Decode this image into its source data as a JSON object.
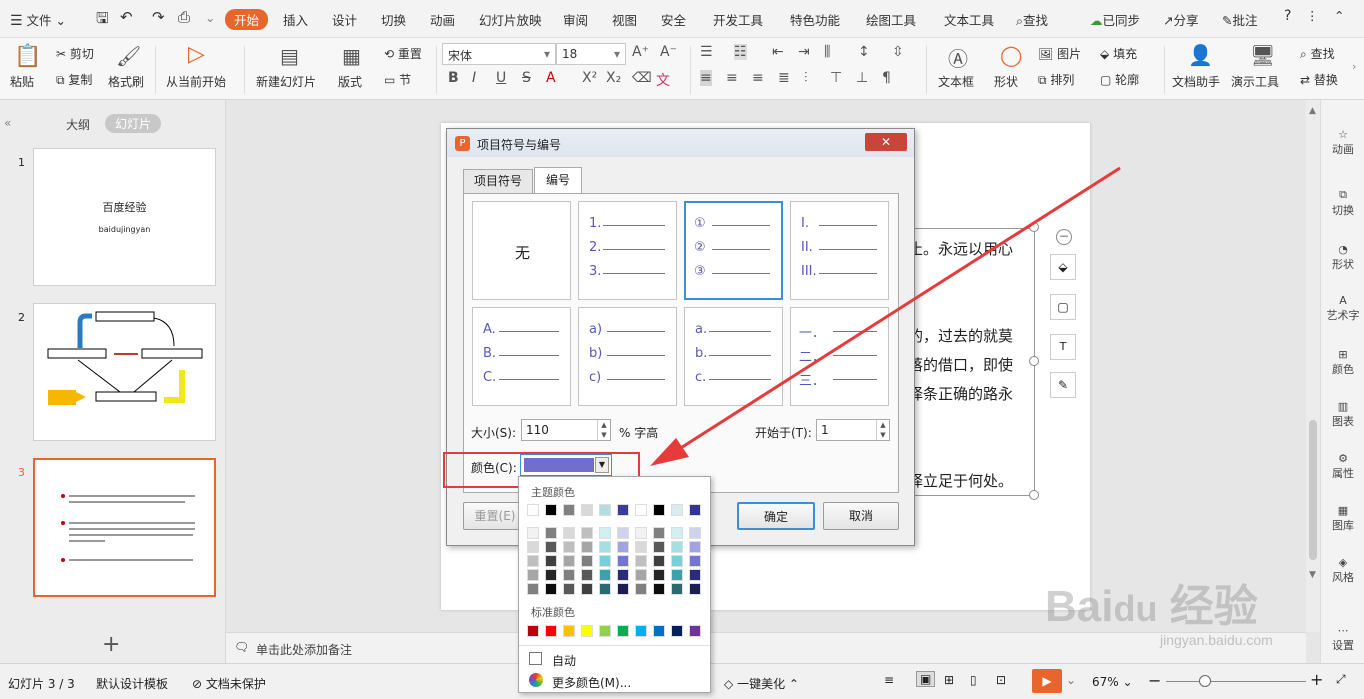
{
  "menu": {
    "file": "文件",
    "tabs": [
      "开始",
      "插入",
      "设计",
      "切换",
      "动画",
      "幻灯片放映",
      "审阅",
      "视图",
      "安全",
      "开发工具",
      "特色功能",
      "绘图工具",
      "文本工具"
    ],
    "search": "查找",
    "sync": "已同步",
    "share": "分享",
    "comment": "批注"
  },
  "ribbon": {
    "paste": "粘贴",
    "cut": "剪切",
    "copy": "复制",
    "format_painter": "格式刷",
    "play_current": "从当前开始",
    "new_slide": "新建幻灯片",
    "layout": "版式",
    "reset": "重置",
    "section": "节",
    "font": "宋体",
    "font_size": "18",
    "textbox": "文本框",
    "shape": "形状",
    "picture": "图片",
    "arrange": "排列",
    "fill": "填充",
    "outline": "轮廓",
    "doc_assistant": "文档助手",
    "present_tools": "演示工具",
    "find": "查找",
    "replace": "替换"
  },
  "left": {
    "outline_tab": "大纲",
    "slides_tab": "幻灯片",
    "thumb1_title": "百度经验",
    "thumb1_sub": "baidujingyan",
    "add": "+"
  },
  "slide_text": [
    "止。永远以用心",
    "的，过去的就莫",
    "落的借口，即使",
    "择条正确的路永",
    "择立足于何处。"
  ],
  "notes": "单击此处添加备注",
  "right_panel": [
    "动画",
    "切换",
    "形状",
    "艺术字",
    "颜色",
    "图表",
    "属性",
    "图库",
    "风格",
    "设置"
  ],
  "status": {
    "slide_num": "幻灯片 3 / 3",
    "template": "默认设计模板",
    "protect": "文档未保护",
    "beautify": "一键美化",
    "zoom": "67%"
  },
  "dialog": {
    "title": "项目符号与编号",
    "tab_bullet": "项目符号",
    "tab_number": "编号",
    "none": "无",
    "size_label": "大小(S):",
    "size_value": "110",
    "pct": "% 字高",
    "start_label": "开始于(T):",
    "start_value": "1",
    "color_label": "颜色(C):",
    "reset": "重置(E)",
    "ok": "确定",
    "cancel": "取消",
    "styles": [
      [
        "1.",
        "2.",
        "3."
      ],
      [
        "①",
        "②",
        "③"
      ],
      [
        "I.",
        "II.",
        "III."
      ],
      [
        "A.",
        "B.",
        "C."
      ],
      [
        "a)",
        "b)",
        "c)"
      ],
      [
        "a.",
        "b.",
        "c."
      ],
      [
        "一．",
        "二．",
        "三．"
      ]
    ]
  },
  "palette": {
    "theme_label": "主题颜色",
    "standard_label": "标准颜色",
    "auto": "自动",
    "more": "更多颜色(M)...",
    "selected_color": "#7070cc",
    "theme_top": [
      "#ffffff",
      "#000000",
      "#808080",
      "#d9d9d9",
      "#b4dde2",
      "#3b3aa0",
      "#ffffff",
      "#000000",
      "#d9eef0",
      "#2f3698"
    ],
    "theme_cols": [
      [
        "#f2f2f2",
        "#d9d9d9",
        "#bfbfbf",
        "#a6a6a6",
        "#808080"
      ],
      [
        "#808080",
        "#595959",
        "#404040",
        "#262626",
        "#0d0d0d"
      ],
      [
        "#d9d9d9",
        "#bfbfbf",
        "#a6a6a6",
        "#808080",
        "#595959"
      ],
      [
        "#bfbfbf",
        "#a6a6a6",
        "#808080",
        "#595959",
        "#404040"
      ],
      [
        "#d2eff1",
        "#a5dfe4",
        "#79cfd6",
        "#3ea0a8",
        "#296b70"
      ],
      [
        "#d1d1f0",
        "#a3a3e1",
        "#7575d2",
        "#2c2b7a",
        "#1d1d51"
      ],
      [
        "#f2f2f2",
        "#d9d9d9",
        "#bfbfbf",
        "#a6a6a6",
        "#808080"
      ],
      [
        "#808080",
        "#595959",
        "#404040",
        "#262626",
        "#0d0d0d"
      ],
      [
        "#d2eff1",
        "#a5dfe4",
        "#79cfd6",
        "#3ea0a8",
        "#296b70"
      ],
      [
        "#d1d1f0",
        "#a3a3e1",
        "#7575d2",
        "#2c2b7a",
        "#1d1d51"
      ]
    ],
    "standard": [
      "#c00000",
      "#ff0000",
      "#ffc000",
      "#ffff00",
      "#92d050",
      "#00b050",
      "#00b0f0",
      "#0070c0",
      "#002060",
      "#7030a0"
    ]
  },
  "colors": {
    "accent": "#e8662e",
    "arrow": "#e53b3b",
    "highlight": "#e53b3b"
  }
}
